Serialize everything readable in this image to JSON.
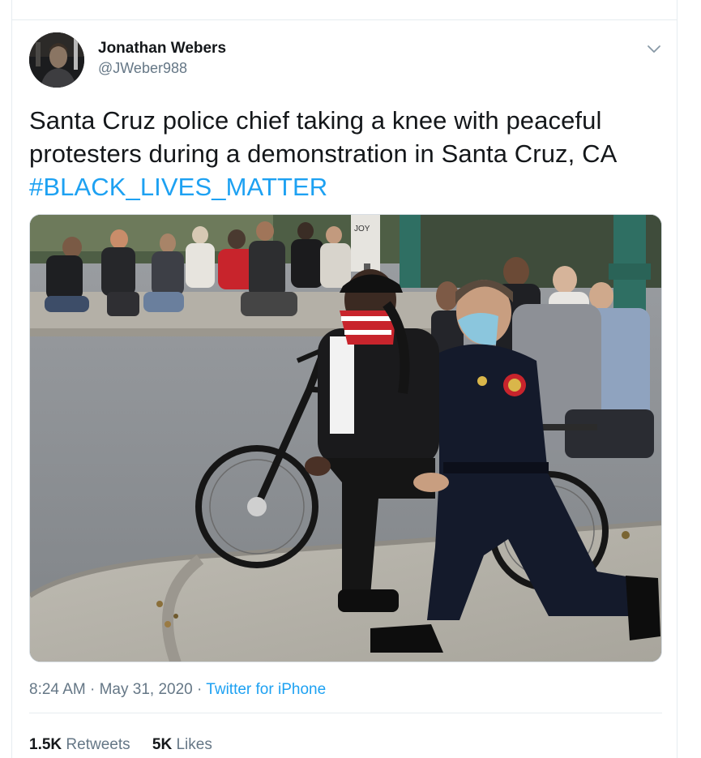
{
  "tweet": {
    "author": {
      "display_name": "Jonathan Webers",
      "handle": "@JWeber988"
    },
    "text_main": "Santa Cruz police chief taking a knee with peaceful protesters during a demonstration in Santa Cruz, CA ",
    "hashtag": "#BLACK_LIVES_MATTER",
    "time": "8:24 AM",
    "separator": " · ",
    "date": "May 31, 2020",
    "source": "Twitter for iPhone",
    "retweets_count": "1.5K",
    "retweets_label": "Retweets",
    "likes_count": "5K",
    "likes_label": "Likes",
    "photo_sign_text": "JOY"
  },
  "colors": {
    "link": "#1da1f2",
    "secondary_text": "#657786",
    "primary_text": "#14171a",
    "divider": "#e6ecf0"
  },
  "icons": {
    "caret": "chevron-down-icon"
  }
}
